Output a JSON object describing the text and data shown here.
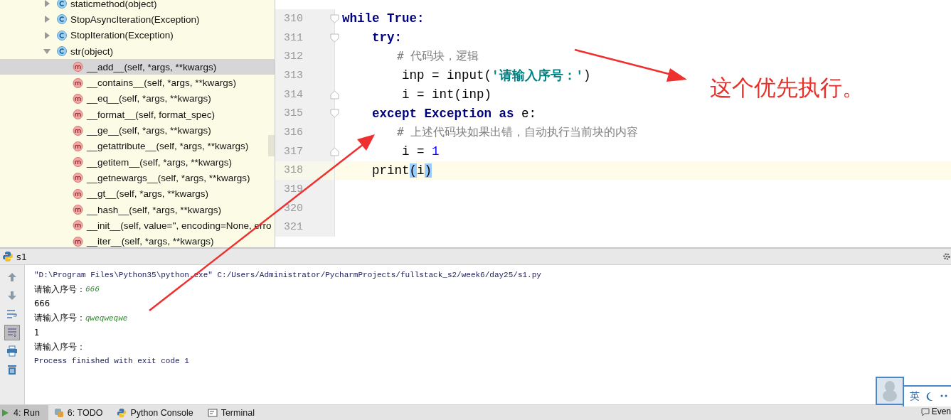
{
  "structure_tree": {
    "items": [
      {
        "label": "staticmethod(object)",
        "kind": "class",
        "expanded": false,
        "selected": false
      },
      {
        "label": "StopAsyncIteration(Exception)",
        "kind": "class",
        "expanded": false,
        "selected": false
      },
      {
        "label": "StopIteration(Exception)",
        "kind": "class",
        "expanded": false,
        "selected": false
      },
      {
        "label": "str(object)",
        "kind": "class",
        "expanded": true,
        "selected": false,
        "children": [
          {
            "label": "__add__(self, *args, **kwargs)",
            "kind": "method",
            "selected": true
          },
          {
            "label": "__contains__(self, *args, **kwargs)",
            "kind": "method",
            "selected": false
          },
          {
            "label": "__eq__(self, *args, **kwargs)",
            "kind": "method",
            "selected": false
          },
          {
            "label": "__format__(self, format_spec)",
            "kind": "method",
            "selected": false
          },
          {
            "label": "__ge__(self, *args, **kwargs)",
            "kind": "method",
            "selected": false
          },
          {
            "label": "__getattribute__(self, *args, **kwargs)",
            "kind": "method",
            "selected": false
          },
          {
            "label": "__getitem__(self, *args, **kwargs)",
            "kind": "method",
            "selected": false
          },
          {
            "label": "__getnewargs__(self, *args, **kwargs)",
            "kind": "method",
            "selected": false
          },
          {
            "label": "__gt__(self, *args, **kwargs)",
            "kind": "method",
            "selected": false
          },
          {
            "label": "__hash__(self, *args, **kwargs)",
            "kind": "method",
            "selected": false
          },
          {
            "label": "__init__(self, value='', encoding=None, erro",
            "kind": "method",
            "selected": false
          },
          {
            "label": "__iter__(self, *args, **kwargs)",
            "kind": "method",
            "selected": false
          }
        ]
      }
    ]
  },
  "editor": {
    "lines": [
      {
        "number": "310",
        "fold_start": true,
        "fold_end": false,
        "current": false,
        "segments": [
          {
            "kind": "keyword",
            "text": "while True:"
          }
        ]
      },
      {
        "number": "311",
        "fold_start": true,
        "fold_end": false,
        "current": false,
        "segments": [
          {
            "kind": "keyword",
            "text": "    try:"
          }
        ]
      },
      {
        "number": "312",
        "fold_start": false,
        "fold_end": false,
        "current": false,
        "segments": [
          {
            "kind": "comment",
            "text": "        # 代码块，逻辑"
          }
        ]
      },
      {
        "number": "313",
        "fold_start": false,
        "fold_end": false,
        "current": false,
        "segments": [
          {
            "kind": "plain",
            "text": "        inp = input("
          },
          {
            "kind": "string",
            "text": "'请输入序号：'"
          },
          {
            "kind": "plain",
            "text": ")"
          }
        ]
      },
      {
        "number": "314",
        "fold_start": false,
        "fold_end": true,
        "current": false,
        "segments": [
          {
            "kind": "plain",
            "text": "        i = int(inp)"
          }
        ]
      },
      {
        "number": "315",
        "fold_start": true,
        "fold_end": false,
        "current": false,
        "segments": [
          {
            "kind": "keyword",
            "text": "    except"
          },
          {
            "kind": "class",
            "text": " Exception"
          },
          {
            "kind": "keyword",
            "text": " as"
          },
          {
            "kind": "plain",
            "text": " e:"
          }
        ]
      },
      {
        "number": "316",
        "fold_start": false,
        "fold_end": false,
        "current": false,
        "segments": [
          {
            "kind": "comment",
            "text": "        # 上述代码块如果出错，自动执行当前块的内容"
          }
        ]
      },
      {
        "number": "317",
        "fold_start": false,
        "fold_end": true,
        "current": false,
        "segments": [
          {
            "kind": "plain",
            "text": "        i = "
          },
          {
            "kind": "number",
            "text": "1"
          }
        ]
      },
      {
        "number": "318",
        "fold_start": false,
        "fold_end": false,
        "current": true,
        "segments": [
          {
            "kind": "plain",
            "text": "    print"
          },
          {
            "kind": "brace",
            "text": "("
          },
          {
            "kind": "plain",
            "text": "i"
          },
          {
            "kind": "brace",
            "text": ")"
          }
        ]
      },
      {
        "number": "319",
        "fold_start": false,
        "fold_end": false,
        "current": false
      },
      {
        "number": "320",
        "fold_start": false,
        "fold_end": false,
        "current": false
      },
      {
        "number": "321",
        "fold_start": false,
        "fold_end": false,
        "current": false
      }
    ]
  },
  "run_panel": {
    "title": "s1",
    "toolbar": [
      {
        "kind": "up",
        "on": false
      },
      {
        "kind": "down",
        "on": false
      },
      {
        "kind": "wrap",
        "on": false
      },
      {
        "kind": "scroll",
        "on": true
      },
      {
        "kind": "print",
        "on": false
      },
      {
        "kind": "trash",
        "on": false
      }
    ],
    "console": [
      {
        "kind": "system",
        "segments": [
          {
            "kind": "plain",
            "text": "\"D:\\Program Files\\Python35\\python.exe\" C:/Users/Administrator/PycharmProjects/fullstack_s2/week6/day25/s1.py"
          }
        ]
      },
      {
        "kind": "output",
        "segments": [
          {
            "kind": "plain",
            "text": "请输入序号："
          },
          {
            "kind": "input",
            "text": "666"
          }
        ]
      },
      {
        "kind": "output",
        "segments": [
          {
            "kind": "plain",
            "text": "666"
          }
        ]
      },
      {
        "kind": "output",
        "segments": [
          {
            "kind": "plain",
            "text": "请输入序号："
          },
          {
            "kind": "input",
            "text": "qweqweqwe"
          }
        ]
      },
      {
        "kind": "output",
        "segments": [
          {
            "kind": "plain",
            "text": "1"
          }
        ]
      },
      {
        "kind": "output",
        "segments": [
          {
            "kind": "plain",
            "text": "请输入序号："
          }
        ]
      },
      {
        "kind": "system",
        "segments": [
          {
            "kind": "plain",
            "text": "Process finished with exit code 1"
          }
        ]
      }
    ]
  },
  "bottom_tabs": [
    {
      "label": "4: Run",
      "kind": "run",
      "selected": true
    },
    {
      "label": "6: TODO",
      "kind": "todo",
      "selected": false
    },
    {
      "label": "Python Console",
      "kind": "python",
      "selected": false
    },
    {
      "label": "Terminal",
      "kind": "terminal",
      "selected": false
    }
  ],
  "event_log": "Even",
  "ime": {
    "label": "英"
  },
  "annotation": {
    "text": "这个优先执行。"
  }
}
